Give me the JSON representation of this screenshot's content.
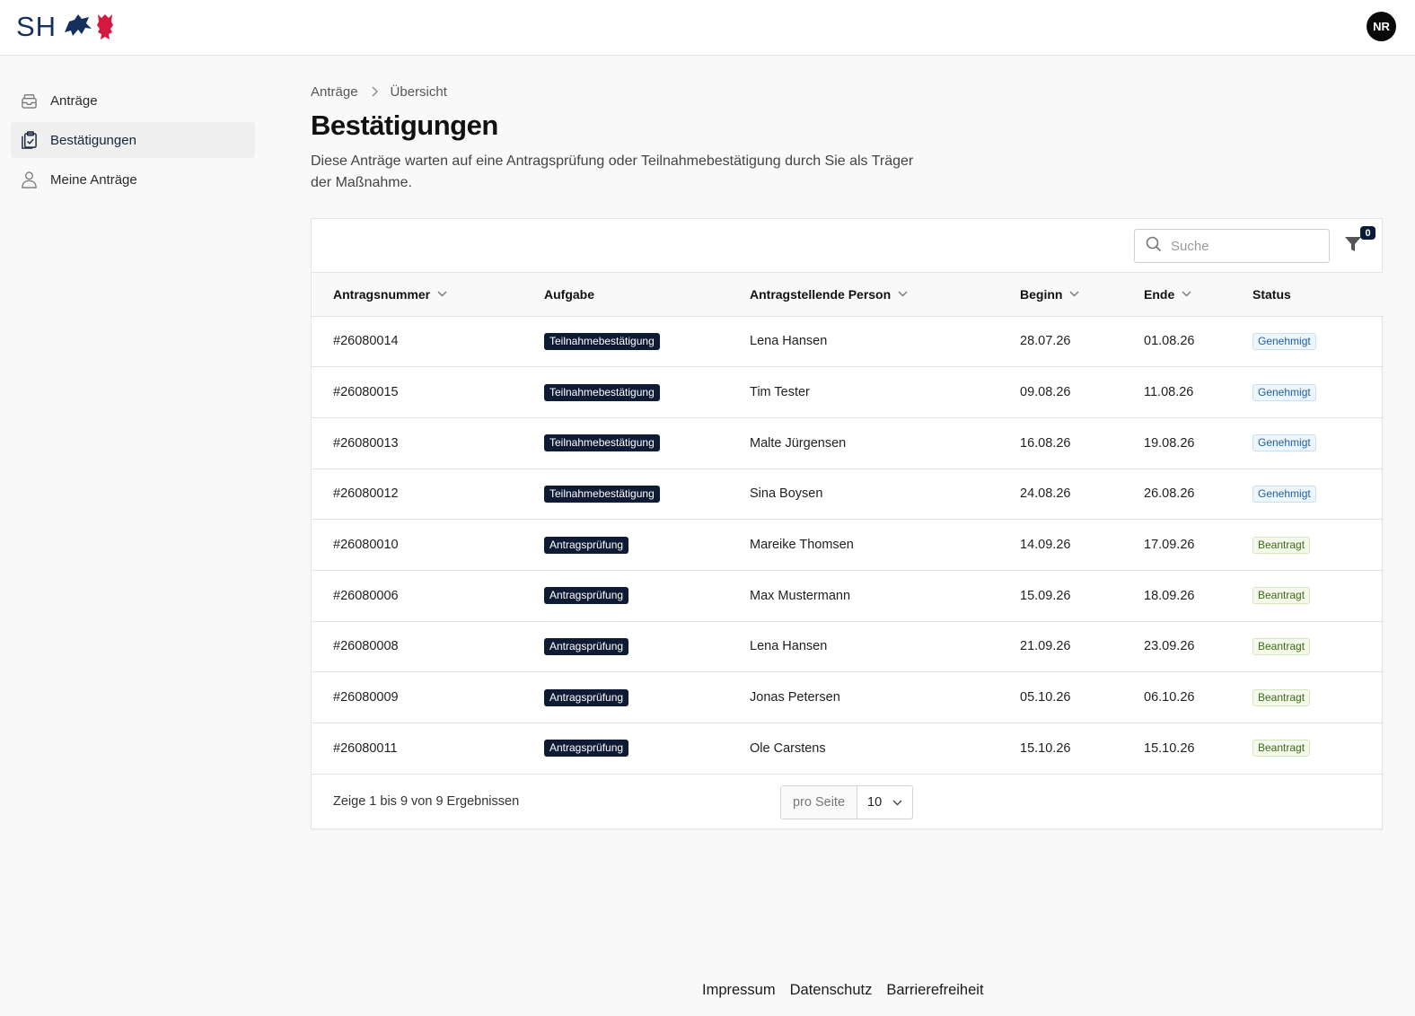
{
  "header": {
    "logo_text": "SH",
    "avatar_initials": "NR"
  },
  "sidebar": {
    "items": [
      {
        "label": "Anträge",
        "icon": "inbox-icon",
        "active": false
      },
      {
        "label": "Bestätigungen",
        "icon": "clipboard-check-icon",
        "active": true
      },
      {
        "label": "Meine Anträge",
        "icon": "user-icon",
        "active": false
      }
    ]
  },
  "breadcrumb": {
    "first": "Anträge",
    "second": "Übersicht"
  },
  "page": {
    "title": "Bestätigungen",
    "description": "Diese Anträge warten auf eine Antragsprüfung oder Teilnahmebestätigung durch Sie als Träger der Maßnahme."
  },
  "toolbar": {
    "search_placeholder": "Suche",
    "filter_count": "0"
  },
  "table": {
    "headers": {
      "number": "Antragsnummer",
      "task": "Aufgabe",
      "person": "Antragstellende Person",
      "start": "Beginn",
      "end": "Ende",
      "status": "Status"
    },
    "rows": [
      {
        "number": "#26080014",
        "task": "Teilnahmebestätigung",
        "person": "Lena Hansen",
        "start": "28.07.26",
        "end": "01.08.26",
        "status": "Genehmigt"
      },
      {
        "number": "#26080015",
        "task": "Teilnahmebestätigung",
        "person": "Tim Tester",
        "start": "09.08.26",
        "end": "11.08.26",
        "status": "Genehmigt"
      },
      {
        "number": "#26080013",
        "task": "Teilnahmebestätigung",
        "person": "Malte Jürgensen",
        "start": "16.08.26",
        "end": "19.08.26",
        "status": "Genehmigt"
      },
      {
        "number": "#26080012",
        "task": "Teilnahmebestätigung",
        "person": "Sina Boysen",
        "start": "24.08.26",
        "end": "26.08.26",
        "status": "Genehmigt"
      },
      {
        "number": "#26080010",
        "task": "Antragsprüfung",
        "person": "Mareike Thomsen",
        "start": "14.09.26",
        "end": "17.09.26",
        "status": "Beantragt"
      },
      {
        "number": "#26080006",
        "task": "Antragsprüfung",
        "person": "Max Mustermann",
        "start": "15.09.26",
        "end": "18.09.26",
        "status": "Beantragt"
      },
      {
        "number": "#26080008",
        "task": "Antragsprüfung",
        "person": "Lena Hansen",
        "start": "21.09.26",
        "end": "23.09.26",
        "status": "Beantragt"
      },
      {
        "number": "#26080009",
        "task": "Antragsprüfung",
        "person": "Jonas Petersen",
        "start": "05.10.26",
        "end": "06.10.26",
        "status": "Beantragt"
      },
      {
        "number": "#26080011",
        "task": "Antragsprüfung",
        "person": "Ole Carstens",
        "start": "15.10.26",
        "end": "15.10.26",
        "status": "Beantragt"
      }
    ]
  },
  "pagination": {
    "result_text": "Zeige 1 bis 9 von 9 Ergebnissen",
    "per_page_label": "pro Seite",
    "per_page_value": "10"
  },
  "footer": {
    "links": [
      "Impressum",
      "Datenschutz",
      "Barrierefreiheit"
    ]
  },
  "colors": {
    "status_genehmigt": "#1e5e9e",
    "status_beantragt": "#3c6a17",
    "badge_dark": "#0f1b35"
  }
}
